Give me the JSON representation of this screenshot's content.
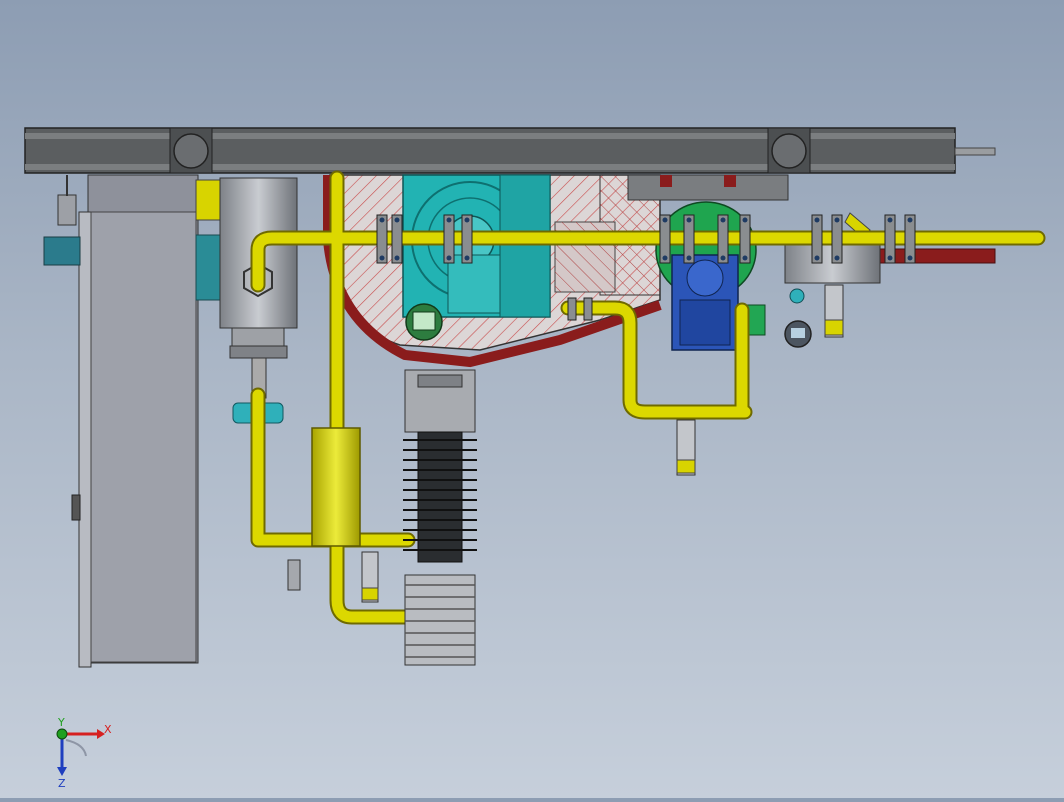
{
  "viewport": {
    "background_top": "#8d9db3",
    "background_bottom": "#c6cfdb"
  },
  "colors": {
    "beam": "#5c5f60",
    "pipe_yellow": "#d8d400",
    "pipe_outline": "#6f6a00",
    "cyan_pump": "#1fb0b0",
    "red_duct": "#8a1c1c",
    "green_motor": "#1ea54e",
    "blue_gearbox": "#2a54b8",
    "panel_gray": "#8c8f9a",
    "hatch": "#c94c4c"
  },
  "triad": {
    "x_label": "X",
    "y_label": "Y",
    "z_label": "Z",
    "x_color": "#d62020",
    "y_color": "#20a020",
    "z_color": "#1f3fbf"
  }
}
